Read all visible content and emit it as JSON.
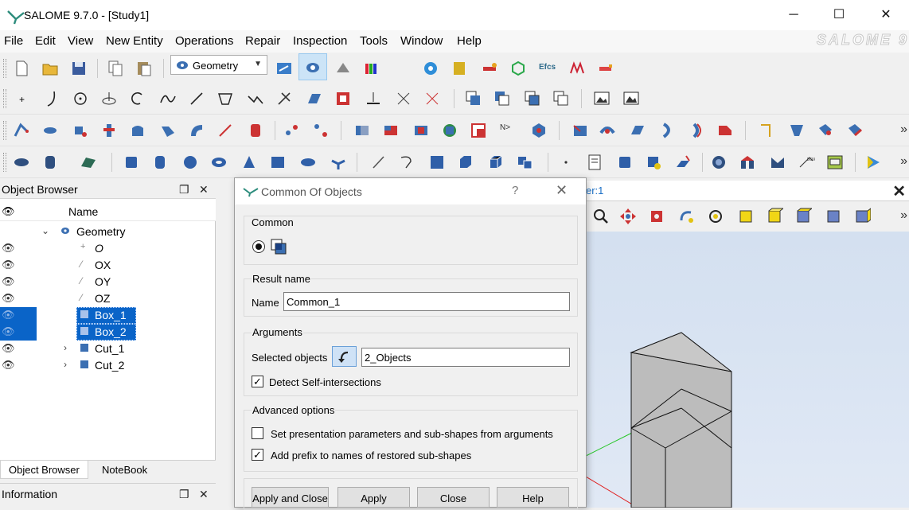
{
  "window": {
    "title": "SALOME  9.7.0 - [Study1]",
    "minimize_glyph": "─",
    "maximize_glyph": "☐",
    "close_glyph": "✕"
  },
  "menu": {
    "items": [
      "File",
      "Edit",
      "View",
      "New Entity",
      "Operations",
      "Repair",
      "Inspection",
      "Tools",
      "Window",
      "Help"
    ],
    "brand": "SALOME 9"
  },
  "toolbar": {
    "module": "Geometry",
    "more_glyph": "»"
  },
  "object_browser": {
    "title": "Object Browser",
    "column_header": "Name",
    "root": "Geometry",
    "items": [
      {
        "label": "O"
      },
      {
        "label": "OX"
      },
      {
        "label": "OY"
      },
      {
        "label": "OZ"
      },
      {
        "label": "Box_1",
        "selected": true
      },
      {
        "label": "Box_2",
        "selected": true
      },
      {
        "label": "Cut_1",
        "expandable": true
      },
      {
        "label": "Cut_2",
        "expandable": true
      }
    ],
    "tabs": [
      "Object Browser",
      "NoteBook"
    ],
    "active_tab": "Object Browser"
  },
  "information": {
    "title": "Information"
  },
  "viewer": {
    "tab_label": "er:1",
    "background_colors": [
      "#d4e0f0",
      "#e1e9f5"
    ]
  },
  "dialog": {
    "title": "Common Of Objects",
    "help_glyph": "?",
    "close_glyph": "✕",
    "common_group": "Common",
    "result_group": "Result name",
    "name_label": "Name",
    "name_value": "Common_1",
    "arguments_group": "Arguments",
    "selected_label": "Selected objects",
    "selected_value": "2_Objects",
    "detect_label": "Detect Self-intersections",
    "detect_checked": true,
    "advanced_group": "Advanced options",
    "set_presentation_label": "Set presentation parameters and sub-shapes from arguments",
    "set_presentation_checked": false,
    "add_prefix_label": "Add prefix to names of restored sub-shapes",
    "add_prefix_checked": true,
    "buttons": {
      "apply_close": "Apply and Close",
      "apply": "Apply",
      "close": "Close",
      "help": "Help"
    },
    "check_glyph": "✓"
  },
  "colors": {
    "selection": "#0a64c8",
    "accent": "#1a6fc7",
    "toolbar_bg": "#f0f0f0"
  }
}
